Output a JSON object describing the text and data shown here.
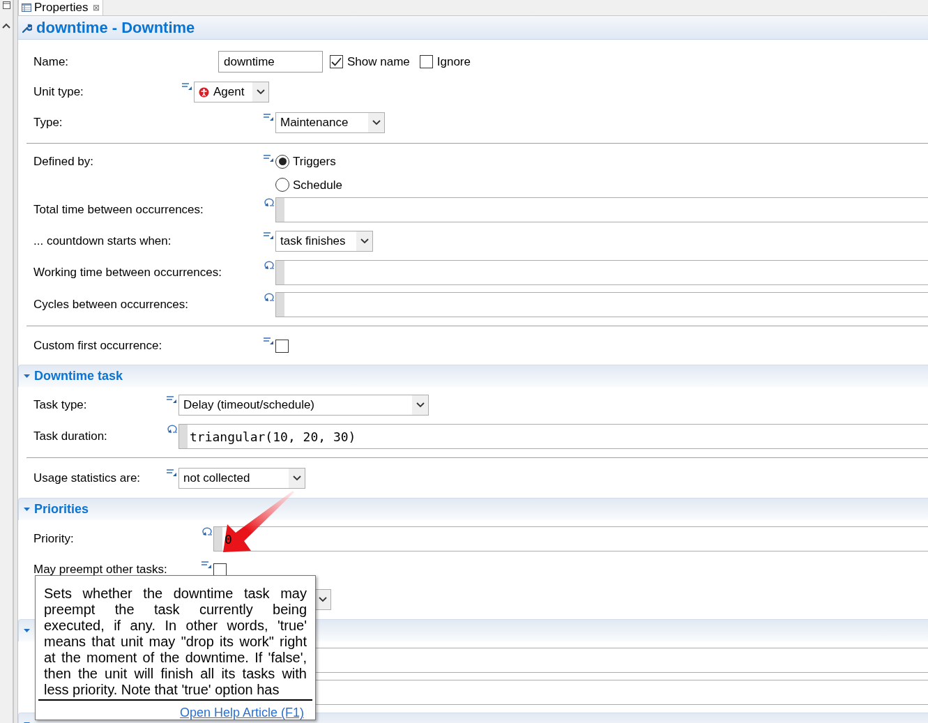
{
  "tab": {
    "label": "Properties",
    "close": "⊠"
  },
  "title": "downtime - Downtime",
  "general": {
    "rows": [
      {
        "kind": "text",
        "label": "Name:",
        "value": "downtime",
        "checks": [
          {
            "label": "Show name",
            "checked": true
          },
          {
            "label": "Ignore",
            "checked": false
          }
        ]
      },
      {
        "kind": "combo",
        "label": "Unit type:",
        "dynamic": false,
        "value": "Agent",
        "has_icon": true
      },
      {
        "kind": "combo",
        "label": "Type:",
        "dynamic": false,
        "value": "Maintenance"
      },
      {
        "kind": "divider"
      },
      {
        "kind": "radio",
        "label": "Defined by:",
        "dynamic": false,
        "options": [
          {
            "label": "Triggers",
            "selected": true
          },
          {
            "label": "Schedule",
            "selected": false
          }
        ]
      },
      {
        "kind": "expression",
        "label": "Total time between occurrences:",
        "dynamic": true
      },
      {
        "kind": "combo",
        "label": "... countdown starts when:",
        "dynamic": false,
        "value": "task finishes"
      },
      {
        "kind": "expression",
        "label": "Working time between occurrences:",
        "dynamic": true
      },
      {
        "kind": "expression",
        "label": "Cycles between occurrences:",
        "dynamic": true
      },
      {
        "kind": "divider"
      },
      {
        "kind": "checkbox",
        "label": "Custom first occurrence:",
        "dynamic": false,
        "checked": false
      }
    ]
  },
  "sections": [
    {
      "title": "Downtime task",
      "expanded": true,
      "rows": [
        {
          "kind": "combo",
          "label": "Task type:",
          "dynamic": false,
          "value": "Delay (timeout/schedule)"
        },
        {
          "kind": "expression",
          "label": "Task duration:",
          "dynamic": true,
          "value": "triangular(10, 20, 30)"
        },
        {
          "kind": "divider"
        },
        {
          "kind": "combo",
          "label": "Usage statistics are:",
          "dynamic": false,
          "value": "not collected"
        }
      ]
    },
    {
      "title": "Priorities",
      "expanded": true,
      "rows": [
        {
          "kind": "expression",
          "label": "Priority:",
          "dynamic": true,
          "value": "0"
        },
        {
          "kind": "checkbox",
          "label": "May preempt other tasks:",
          "dynamic": false,
          "checked": false
        },
        {
          "kind": "combo"
        }
      ]
    },
    {
      "expanded": true,
      "rows": [
        {
          "kind": "expression"
        },
        {
          "kind": "expression"
        }
      ]
    },
    {
      "expanded": true
    }
  ],
  "tooltip": {
    "text": "Sets whether the downtime task may preempt the task currently being executed, if any. In other words, 'true' means that unit may \"drop its work\" right at the moment of the downtime. If 'false', then the unit will finish all its tasks with less priority. Note that 'true' option has",
    "link": "Open Help Article (F1)"
  }
}
